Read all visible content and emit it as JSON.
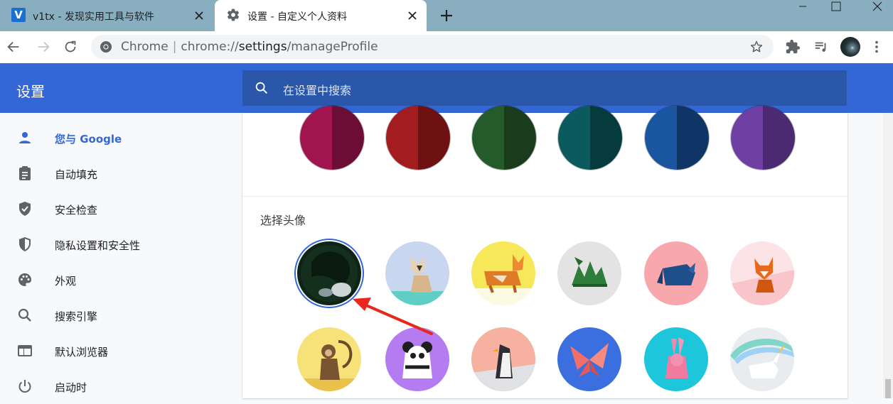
{
  "tabs": [
    {
      "title": "v1tx - 发现实用工具与软件",
      "favicon_letter": "V"
    },
    {
      "title": "设置 - 自定义个人资料"
    }
  ],
  "omnibox": {
    "host_label": "Chrome",
    "url_scheme": "chrome://",
    "url_host": "settings",
    "url_path": "/manageProfile"
  },
  "header": {
    "title": "设置",
    "search_placeholder": "在设置中搜索"
  },
  "sidebar": {
    "items": [
      {
        "label": "您与 Google",
        "icon": "person-icon",
        "active": true
      },
      {
        "label": "自动填充",
        "icon": "clipboard-icon"
      },
      {
        "label": "安全检查",
        "icon": "shield-check-icon"
      },
      {
        "label": "隐私设置和安全性",
        "icon": "shield-half-icon"
      },
      {
        "label": "外观",
        "icon": "palette-icon"
      },
      {
        "label": "搜索引擎",
        "icon": "search-icon"
      },
      {
        "label": "默认浏览器",
        "icon": "browser-icon"
      },
      {
        "label": "启动时",
        "icon": "power-icon"
      }
    ]
  },
  "theme_colors": [
    {
      "left": "#a0154f",
      "right": "#6b0d34"
    },
    {
      "left": "#a31c20",
      "right": "#6d1113"
    },
    {
      "left": "#255a2a",
      "right": "#1a3b1c"
    },
    {
      "left": "#0a5a5e",
      "right": "#063b3e"
    },
    {
      "left": "#1a55a0",
      "right": "#0f3466"
    },
    {
      "left": "#6f3fa3",
      "right": "#4b2a72"
    }
  ],
  "avatar_section": {
    "label": "选择头像"
  },
  "avatars": [
    {
      "name": "current-photo-avatar",
      "selected": true
    },
    {
      "name": "origami-cat-avatar"
    },
    {
      "name": "origami-corgi-avatar"
    },
    {
      "name": "origami-dragon-avatar"
    },
    {
      "name": "origami-elephant-avatar"
    },
    {
      "name": "origami-fox-avatar"
    },
    {
      "name": "origami-monkey-avatar"
    },
    {
      "name": "origami-panda-avatar"
    },
    {
      "name": "origami-penguin-avatar"
    },
    {
      "name": "origami-butterfly-avatar"
    },
    {
      "name": "origami-rabbit-avatar"
    },
    {
      "name": "origami-unicorn-avatar"
    }
  ],
  "colors": {
    "accent": "#3367d6",
    "header_bg": "#3367d6",
    "search_bg": "#2b57ab",
    "annotation_arrow": "#e8261e"
  }
}
